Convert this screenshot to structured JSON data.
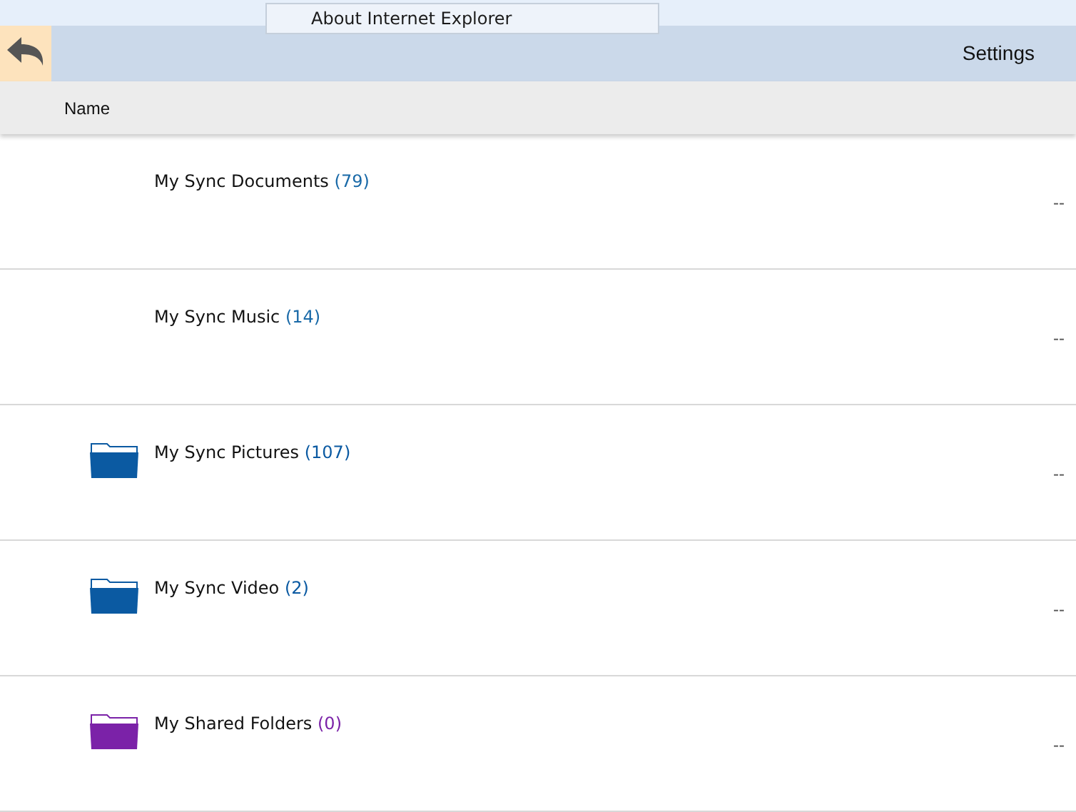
{
  "menu": {
    "item": "About Internet Explorer"
  },
  "toolbar": {
    "title": "Settings"
  },
  "columns": [
    "Name"
  ],
  "rows": [
    {
      "kind": "plain",
      "name": "My Sync Documents",
      "count": "(79)",
      "color": "#1a6aa8",
      "value": "--"
    },
    {
      "kind": "plain",
      "name": "My Sync Music",
      "count": "(14)",
      "color": "#1a6aa8",
      "value": "--"
    },
    {
      "kind": "folder",
      "name": "My Sync Pictures",
      "count": "(107)",
      "color": "#0b5aa2",
      "value": "--"
    },
    {
      "kind": "folder",
      "name": "My Sync Video",
      "count": "(2)",
      "color": "#0b5aa2",
      "value": "--"
    },
    {
      "kind": "folder",
      "name": "My Shared Folders",
      "count": "(0)",
      "color": "#7b22a8",
      "value": "--"
    }
  ]
}
